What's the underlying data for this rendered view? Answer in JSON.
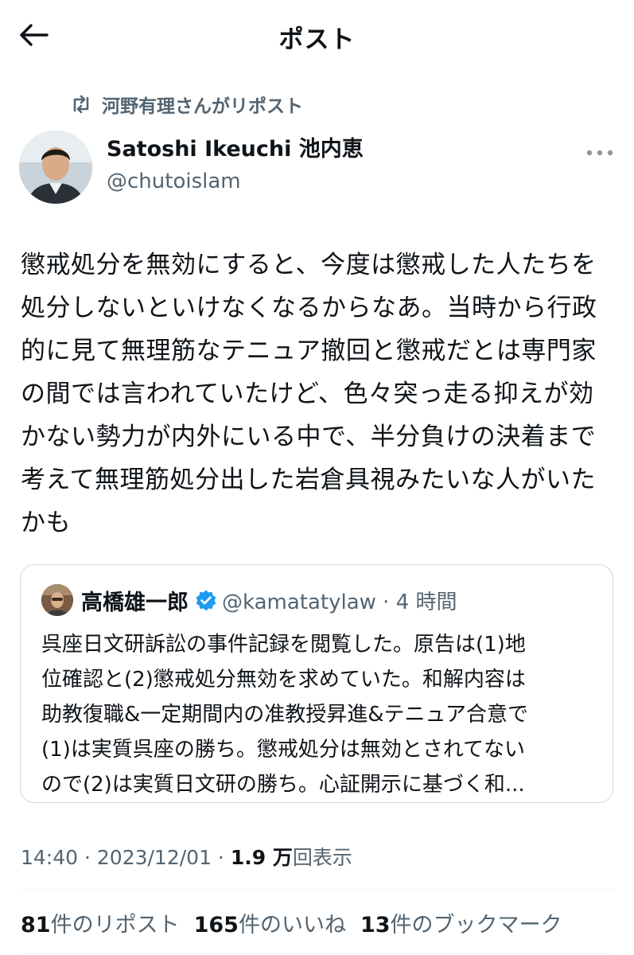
{
  "header": {
    "title": "ポスト",
    "back_icon": "arrow-left-icon"
  },
  "repost": {
    "icon": "repost-icon",
    "label": "河野有理さんがリポスト"
  },
  "author": {
    "name": "Satoshi Ikeuchi 池内恵",
    "handle": "@chutoislam"
  },
  "more_icon": "more-dots-icon",
  "post": {
    "text": "懲戒処分を無効にすると、今度は懲戒した人たちを\n処分しないといけなくなるからなあ。当時から行政\n的に見て無理筋なテニュア撤回と懲戒だとは専門家\nの間では言われていたけど、色々突っ走る抑えが効\nかない勢力が内外にいる中で、半分負けの決着まで\n考えて無理筋処分出した岩倉具視みたいな人がいた\nかも"
  },
  "quote": {
    "name": "高橋雄一郎",
    "handle_time": "@kamatatylaw · 4 時間",
    "verified_icon": "verified-badge-icon",
    "text": "呉座日文研訴訟の事件記録を閲覧した。原告は(1)地\n位確認と(2)懲戒処分無効を求めていた。和解内容は\n助教復職&一定期間内の准教授昇進&テニュア合意で\n(1)は実質呉座の勝ち。懲戒処分は無効とされてない\nので(2)は実質日文研の勝ち。心証開示に基づく和..."
  },
  "meta": {
    "time": "14:40 · 2023/12/01 · ",
    "views_count": "1.9 万",
    "views_label": "回表示"
  },
  "stats": [
    {
      "count": "81",
      "label": "件のリポスト"
    },
    {
      "count": "165",
      "label": "件のいいね"
    },
    {
      "count": "13",
      "label": "件のブックマーク"
    }
  ],
  "colors": {
    "text": "#0f1419",
    "secondary": "#536471",
    "verified": "#1d9bf0",
    "border": "#cfd9de"
  }
}
